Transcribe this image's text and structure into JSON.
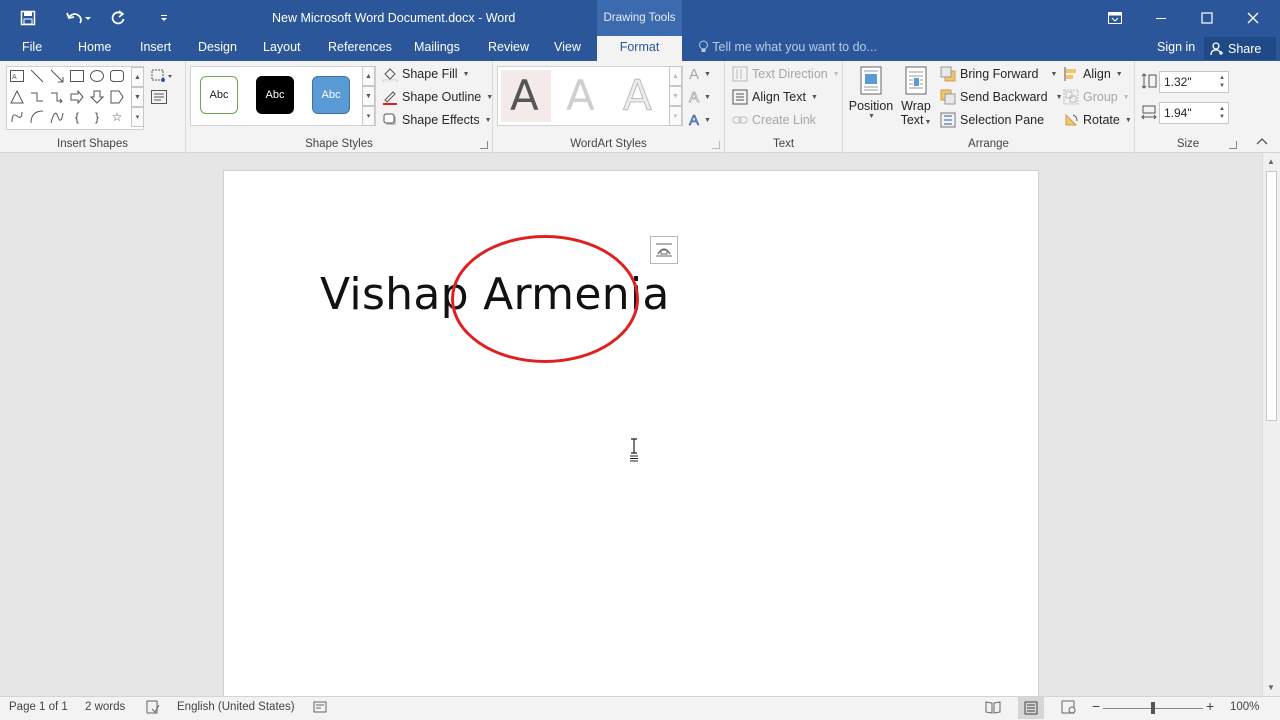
{
  "titlebar": {
    "doc_title": "New Microsoft Word Document.docx - Word",
    "context_tab_group": "Drawing Tools",
    "icons": [
      "save-icon",
      "undo-icon",
      "redo-icon",
      "customize-qat-icon",
      "ribbon-display-icon",
      "minimize-icon",
      "maximize-icon",
      "close-icon"
    ]
  },
  "tabs": {
    "file": "File",
    "home": "Home",
    "insert": "Insert",
    "design": "Design",
    "layout": "Layout",
    "references": "References",
    "mailings": "Mailings",
    "review": "Review",
    "view": "View",
    "format": "Format",
    "active": "Format"
  },
  "tell_me": "Tell me what you want to do...",
  "sign_in": "Sign in",
  "share": "Share",
  "ribbon": {
    "insert_shapes": {
      "label": "Insert Shapes"
    },
    "shape_styles": {
      "label": "Shape Styles",
      "swatch_text": "Abc",
      "shape_fill": "Shape Fill",
      "shape_outline": "Shape Outline",
      "shape_effects": "Shape Effects"
    },
    "wordart_styles": {
      "label": "WordArt Styles",
      "letter": "A"
    },
    "text": {
      "label": "Text",
      "text_direction": "Text Direction",
      "align_text": "Align Text",
      "create_link": "Create Link"
    },
    "arrange": {
      "label": "Arrange",
      "position": "Position",
      "wrap_text_1": "Wrap",
      "wrap_text_2": "Text",
      "bring_forward": "Bring Forward",
      "send_backward": "Send Backward",
      "selection_pane": "Selection Pane",
      "align": "Align",
      "group": "Group",
      "rotate": "Rotate"
    },
    "size": {
      "label": "Size",
      "height": "1.32\"",
      "width": "1.94\""
    }
  },
  "document": {
    "text": "Vishap Armenia"
  },
  "statusbar": {
    "page": "Page 1 of 1",
    "words": "2 words",
    "language": "English (United States)",
    "zoom": "100%"
  },
  "colors": {
    "brand": "#2b579a",
    "ellipse_outline": "#e02020"
  }
}
